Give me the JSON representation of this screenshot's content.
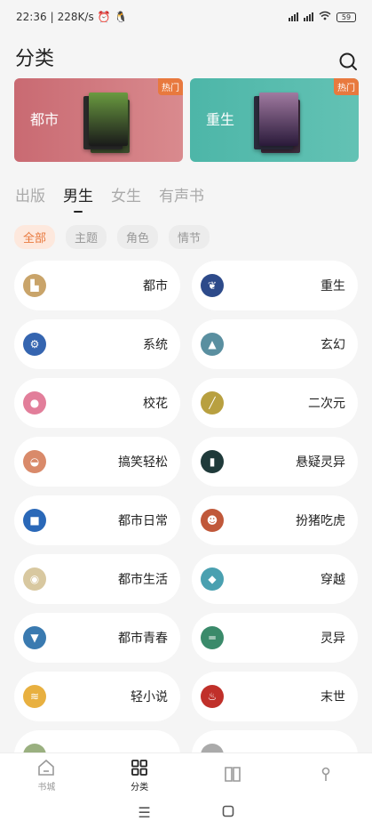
{
  "status": {
    "time": "22:36",
    "net": "228K/s",
    "battery": "59"
  },
  "header": {
    "title": "分类"
  },
  "banners": [
    {
      "label": "都市",
      "badge": "热门",
      "color": "#c96a72"
    },
    {
      "label": "重生",
      "badge": "热门",
      "color": "#4db6a8"
    }
  ],
  "tabs": [
    {
      "label": "出版"
    },
    {
      "label": "男生"
    },
    {
      "label": "女生"
    },
    {
      "label": "有声书"
    }
  ],
  "chips": [
    {
      "label": "全部"
    },
    {
      "label": "主题"
    },
    {
      "label": "角色"
    },
    {
      "label": "情节"
    }
  ],
  "categories": [
    {
      "name": "都市",
      "icon": "city-icon",
      "color": "#c9a46a"
    },
    {
      "name": "重生",
      "icon": "butterfly-icon",
      "color": "#2d4a8a"
    },
    {
      "name": "系统",
      "icon": "gear-icon",
      "color": "#3565b0"
    },
    {
      "name": "玄幻",
      "icon": "mountain-icon",
      "color": "#5a8fa0"
    },
    {
      "name": "校花",
      "icon": "girl-icon",
      "color": "#e27e9a"
    },
    {
      "name": "二次元",
      "icon": "wand-icon",
      "color": "#b8a040"
    },
    {
      "name": "搞笑轻松",
      "icon": "landscape-icon",
      "color": "#d98a6a"
    },
    {
      "name": "悬疑灵异",
      "icon": "card-icon",
      "color": "#1f3a3a"
    },
    {
      "name": "都市日常",
      "icon": "cube-icon",
      "color": "#2a68b8"
    },
    {
      "name": "扮猪吃虎",
      "icon": "face-icon",
      "color": "#c0583a"
    },
    {
      "name": "都市生活",
      "icon": "cup-icon",
      "color": "#d8c8a0"
    },
    {
      "name": "穿越",
      "icon": "drop-icon",
      "color": "#4aa0b0"
    },
    {
      "name": "都市青春",
      "icon": "shirt-icon",
      "color": "#3a7ab0"
    },
    {
      "name": "灵异",
      "icon": "ghost-icon",
      "color": "#3a8a6a"
    },
    {
      "name": "轻小说",
      "icon": "hand-icon",
      "color": "#e8b040"
    },
    {
      "name": "末世",
      "icon": "fire-icon",
      "color": "#c0302a"
    }
  ],
  "bottom_nav": [
    {
      "label": "书城",
      "icon": "home-icon"
    },
    {
      "label": "分类",
      "icon": "grid-icon"
    },
    {
      "label": "",
      "icon": "book-icon"
    },
    {
      "label": "",
      "icon": "user-icon"
    }
  ],
  "colors": {
    "accent": "#e8793e",
    "background": "#f5f5f5"
  }
}
